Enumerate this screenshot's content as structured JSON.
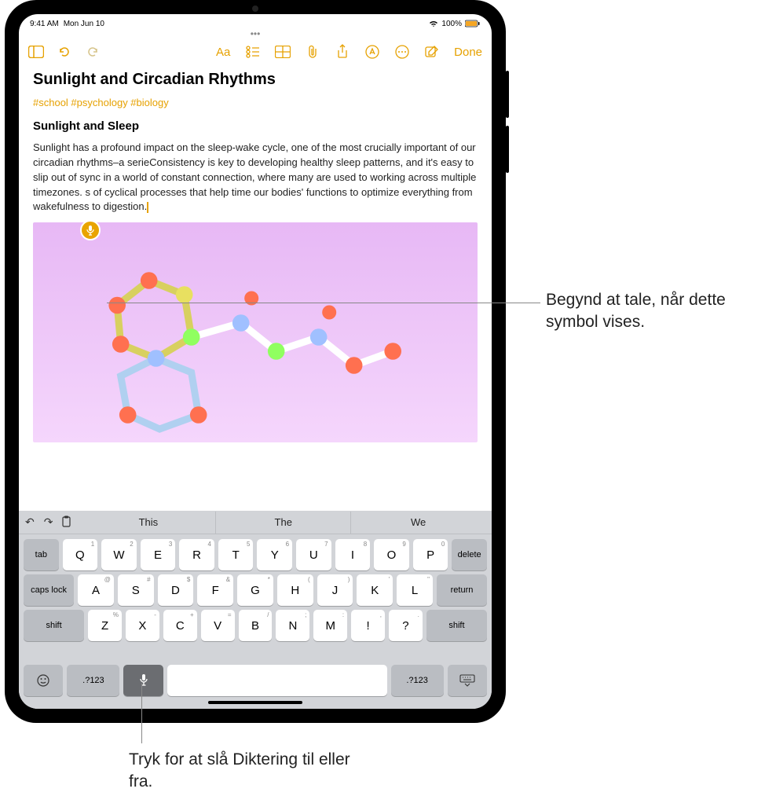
{
  "status": {
    "time": "9:41 AM",
    "date": "Mon Jun 10",
    "battery": "100%"
  },
  "toolbar": {
    "done_label": "Done"
  },
  "note": {
    "title": "Sunlight and Circadian Rhythms",
    "tags": "#school #psychology #biology",
    "subhead": "Sunlight and Sleep",
    "body": "Sunlight has a profound impact on the sleep-wake cycle, one of the most crucially important of our circadian rhythms–a serieConsistency is key to developing healthy sleep patterns, and it's easy to slip out of sync in a world of constant connection, where many are used to working across multiple timezones. s of cyclical processes that help time our bodies' functions to optimize everything from wakefulness to digestion."
  },
  "keyboard": {
    "suggestions": [
      "This",
      "The",
      "We"
    ],
    "row1": [
      {
        "main": "Q",
        "sub": "1"
      },
      {
        "main": "W",
        "sub": "2"
      },
      {
        "main": "E",
        "sub": "3"
      },
      {
        "main": "R",
        "sub": "4"
      },
      {
        "main": "T",
        "sub": "5"
      },
      {
        "main": "Y",
        "sub": "6"
      },
      {
        "main": "U",
        "sub": "7"
      },
      {
        "main": "I",
        "sub": "8"
      },
      {
        "main": "O",
        "sub": "9"
      },
      {
        "main": "P",
        "sub": "0"
      }
    ],
    "row2": [
      {
        "main": "A",
        "sub": "@"
      },
      {
        "main": "S",
        "sub": "#"
      },
      {
        "main": "D",
        "sub": "$"
      },
      {
        "main": "F",
        "sub": "&"
      },
      {
        "main": "G",
        "sub": "*"
      },
      {
        "main": "H",
        "sub": "("
      },
      {
        "main": "J",
        "sub": ")"
      },
      {
        "main": "K",
        "sub": "'"
      },
      {
        "main": "L",
        "sub": "\""
      }
    ],
    "row3": [
      {
        "main": "Z",
        "sub": "%"
      },
      {
        "main": "X",
        "sub": "-"
      },
      {
        "main": "C",
        "sub": "+"
      },
      {
        "main": "V",
        "sub": "="
      },
      {
        "main": "B",
        "sub": "/"
      },
      {
        "main": "N",
        "sub": ";"
      },
      {
        "main": "M",
        "sub": ":"
      },
      {
        "main": "!",
        "sub": ","
      },
      {
        "main": "?",
        "sub": "."
      }
    ],
    "fn": {
      "tab": "tab",
      "delete": "delete",
      "caps": "caps lock",
      "return": "return",
      "shift": "shift",
      "numbers": ".?123"
    }
  },
  "callouts": {
    "mic_indicator": "Begynd at tale, når dette symbol vises.",
    "mic_key": "Tryk for at slå Diktering til eller fra."
  }
}
